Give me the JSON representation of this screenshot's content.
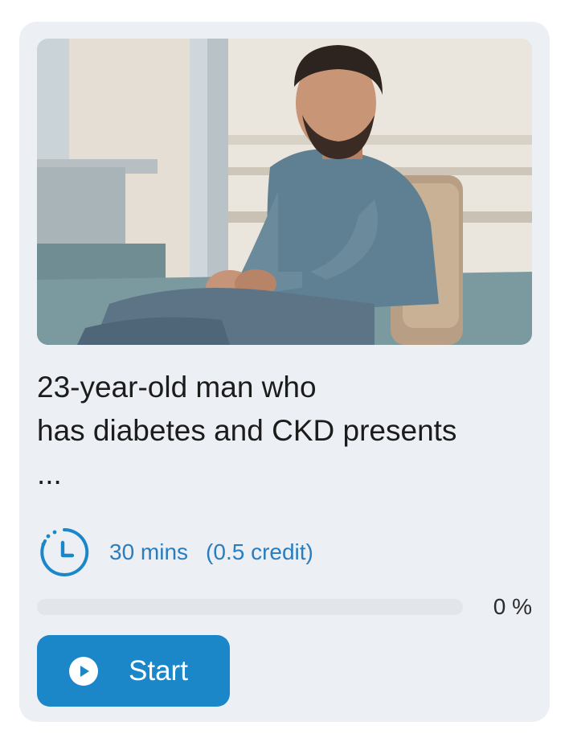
{
  "card": {
    "title_line1": "23-year-old man who",
    "title_line2": "has diabetes and CKD presents",
    "title_line3": "...",
    "duration": "30 mins",
    "credit": "(0.5 credit)",
    "progress_percent": 0,
    "progress_label": "0 %",
    "start_label": "Start",
    "thumbnail_icon": "patient-photo",
    "clock_icon": "clock-icon",
    "play_icon": "play-icon"
  },
  "colors": {
    "accent": "#1b87c9",
    "meta_text": "#2a7dbe",
    "card_bg": "#eceff3"
  }
}
